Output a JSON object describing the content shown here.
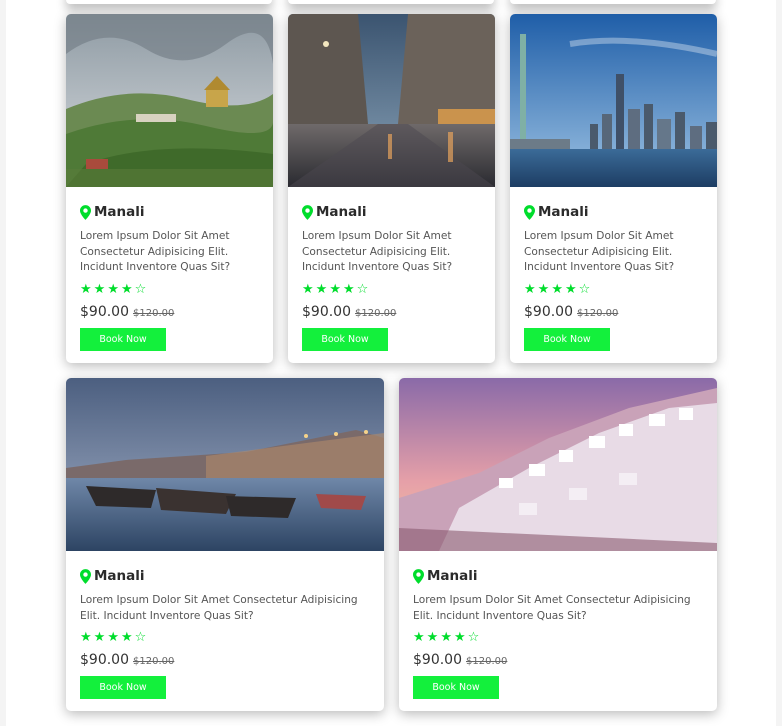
{
  "colors": {
    "accent": "#13f03c",
    "star": "#00dd2c",
    "pin": "#00dd2c"
  },
  "cards": [
    {
      "image": "hill-monastery-valley",
      "title": "Manali",
      "description": "Lorem Ipsum Dolor Sit Amet Consectetur Adipisicing Elit. Incidunt Inventore Quas Sit?",
      "rating": 4,
      "rating_max": 5,
      "price": "$90.00",
      "old_price": "$120.00",
      "button": "Book Now"
    },
    {
      "image": "rainy-city-street-night",
      "title": "Manali",
      "description": "Lorem Ipsum Dolor Sit Amet Consectetur Adipisicing Elit. Incidunt Inventore Quas Sit?",
      "rating": 4,
      "rating_max": 5,
      "price": "$90.00",
      "old_price": "$120.00",
      "button": "Book Now"
    },
    {
      "image": "city-skyline-harbor",
      "title": "Manali",
      "description": "Lorem Ipsum Dolor Sit Amet Consectetur Adipisicing Elit. Incidunt Inventore Quas Sit?",
      "rating": 4,
      "rating_max": 5,
      "price": "$90.00",
      "old_price": "$120.00",
      "button": "Book Now"
    },
    {
      "image": "riverside-ghats-boats",
      "title": "Manali",
      "description": "Lorem Ipsum Dolor Sit Amet Consectetur Adipisicing Elit. Incidunt Inventore Quas Sit?",
      "rating": 4,
      "rating_max": 5,
      "price": "$90.00",
      "old_price": "$120.00",
      "button": "Book Now"
    },
    {
      "image": "white-village-sunset",
      "title": "Manali",
      "description": "Lorem Ipsum Dolor Sit Amet Consectetur Adipisicing Elit. Incidunt Inventore Quas Sit?",
      "rating": 4,
      "rating_max": 5,
      "price": "$90.00",
      "old_price": "$120.00",
      "button": "Book Now"
    }
  ]
}
